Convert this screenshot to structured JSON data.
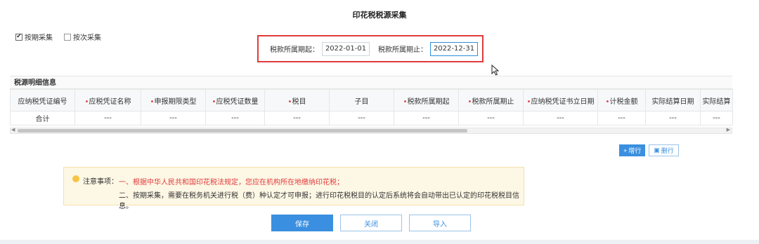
{
  "page": {
    "title": "印花税税源采集"
  },
  "mode": {
    "options": [
      {
        "label": "按期采集",
        "checked": true
      },
      {
        "label": "按次采集",
        "checked": false
      }
    ]
  },
  "period": {
    "start_label": "税款所属期起：",
    "start_value": "2022-01-01",
    "end_label": "税款所属期止：",
    "end_value": "2022-12-31"
  },
  "detail": {
    "section_title": "税源明细信息",
    "columns": [
      {
        "label": "应纳税凭证编号",
        "required": false
      },
      {
        "label": "应税凭证名称",
        "required": true
      },
      {
        "label": "申报期限类型",
        "required": true
      },
      {
        "label": "应税凭证数量",
        "required": true
      },
      {
        "label": "税目",
        "required": true
      },
      {
        "label": "子目",
        "required": false
      },
      {
        "label": "税款所属期起",
        "required": true
      },
      {
        "label": "税款所属期止",
        "required": true
      },
      {
        "label": "应纳税凭证书立日期",
        "required": true
      },
      {
        "label": "计税金额",
        "required": true
      },
      {
        "label": "实际结算日期",
        "required": false
      },
      {
        "label": "实际结算",
        "required": false
      }
    ],
    "total_row": [
      "合计",
      "---",
      "---",
      "---",
      "---",
      "---",
      "---",
      "---",
      "---",
      "---",
      "---",
      "---"
    ]
  },
  "row_buttons": {
    "add_label": "增行",
    "delete_label": "删行"
  },
  "notice": {
    "label": "注意事项：",
    "line1": "一、根据中华人民共和国印花税法规定，您应在机构所在地缴纳印花税；",
    "line2": "二、按期采集，需要在税务机关进行税（费）种认定才可申报；进行印花税税目的认定后系统将会自动带出已认定的印花税税目信息。"
  },
  "actions": {
    "save": "保存",
    "close": "关闭",
    "import": "导入"
  },
  "colors": {
    "accent": "#3b8fe0",
    "highlight_border": "#e03b3b",
    "notice_bg": "#fdf7e5"
  }
}
